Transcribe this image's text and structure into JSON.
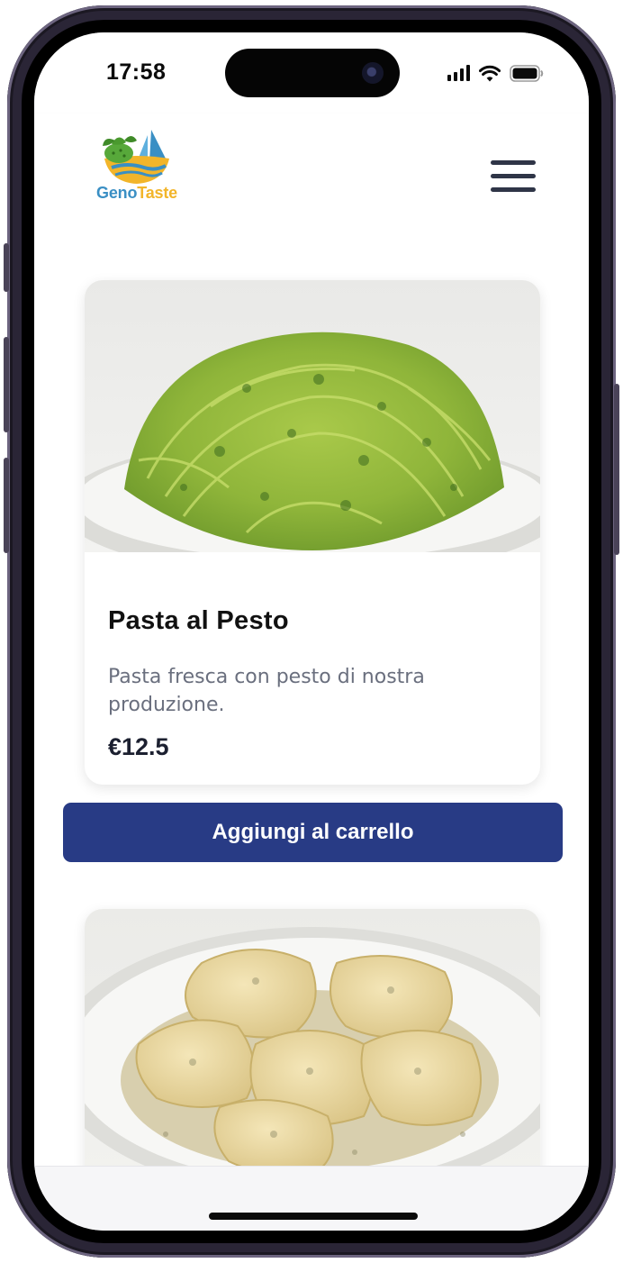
{
  "status_bar": {
    "time": "17:58",
    "icons": [
      "signal-icon",
      "wifi-icon",
      "battery-icon"
    ]
  },
  "header": {
    "logo_text_part1": "Geno",
    "logo_text_part2": "Taste",
    "menu_icon": "hamburger-menu-icon"
  },
  "products": [
    {
      "title": "Pasta al Pesto",
      "description": "Pasta fresca con pesto di nostra produzione.",
      "price": "€12.5",
      "add_button_label": "Aggiungi al carrello"
    },
    {
      "image": "ravioli-dish"
    }
  ],
  "colors": {
    "primary_button": "#283b85",
    "logo_blue": "#3a8fc4",
    "logo_yellow": "#f2b52a",
    "logo_green": "#57a83a",
    "text_dark": "#111111",
    "text_muted": "#6a6f7e"
  }
}
